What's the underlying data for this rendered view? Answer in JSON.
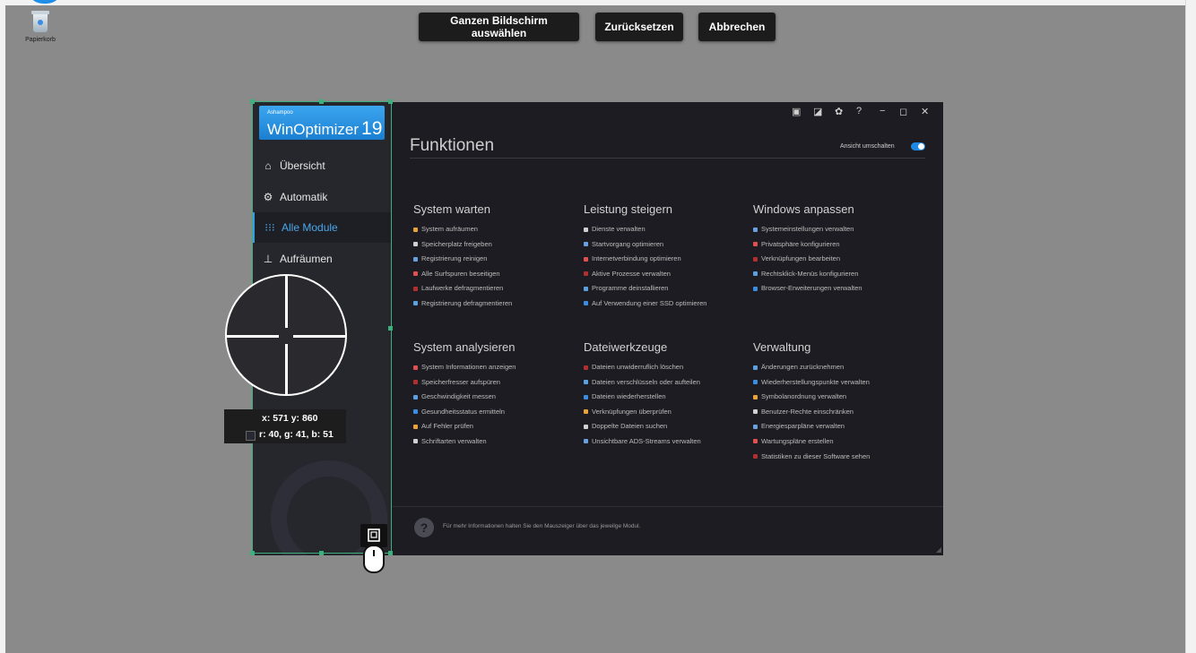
{
  "desktop": {
    "recycle_bin_label": "Papierkorb",
    "background_color": "#8a8a8a"
  },
  "overlay": {
    "buttons": [
      "Ganzen Bildschirm auswählen",
      "Zurücksetzen",
      "Abbrechen"
    ],
    "coords": "x: 571 y: 860",
    "rgb": "r: 40, g: 41, b: 51",
    "selection_color": "#3bb07a"
  },
  "app": {
    "brand": "Ashampoo",
    "name": "WinOptimizer",
    "version": "19",
    "accent": "#1e88e5",
    "window_controls": [
      "chat-icon",
      "note-icon",
      "gear-icon",
      "help-icon",
      "minimize-icon",
      "maximize-icon",
      "close-icon"
    ],
    "window_control_glyphs": [
      "▣",
      "◪",
      "✿",
      "?",
      "−",
      "◻",
      "✕"
    ],
    "nav": [
      {
        "label": "Übersicht",
        "icon": "home-icon",
        "glyph": "⌂"
      },
      {
        "label": "Automatik",
        "icon": "automation-icon",
        "glyph": "⚙"
      },
      {
        "label": "Alle Module",
        "icon": "grid-icon",
        "glyph": "⁝⁝⁝",
        "active": true
      },
      {
        "label": "Aufräumen",
        "icon": "broom-icon",
        "glyph": "⊥"
      }
    ],
    "title": "Funktionen",
    "toggle_label": "Ansicht umschalten",
    "groups": [
      {
        "title": "System warten",
        "items": [
          "System aufräumen",
          "Speicherplatz freigeben",
          "Registrierung reinigen",
          "Alle Surfspuren beseitigen",
          "Laufwerke defragmentieren",
          "Registrierung defragmentieren"
        ]
      },
      {
        "title": "Leistung steigern",
        "items": [
          "Dienste verwalten",
          "Startvorgang optimieren",
          "Internetverbindung optimieren",
          "Aktive Prozesse verwalten",
          "Programme deinstallieren",
          "Auf Verwendung einer SSD optimieren"
        ]
      },
      {
        "title": "Windows anpassen",
        "items": [
          "Systemeinstellungen verwalten",
          "Privatsphäre konfigurieren",
          "Verknüpfungen bearbeiten",
          "Rechtsklick-Menüs konfigurieren",
          "Browser-Erweiterungen verwalten"
        ]
      },
      {
        "title": "System analysieren",
        "items": [
          "System Informationen anzeigen",
          "Speicherfresser aufspüren",
          "Geschwindigkeit messen",
          "Gesundheitsstatus ermitteln",
          "Auf Fehler prüfen",
          "Schriftarten verwalten"
        ]
      },
      {
        "title": "Dateiwerkzeuge",
        "items": [
          "Dateien unwiderruflich löschen",
          "Dateien verschlüsseln oder aufteilen",
          "Dateien wiederherstellen",
          "Verknüpfungen überprüfen",
          "Doppelte Dateien suchen",
          "Unsichtbare ADS-Streams verwalten"
        ]
      },
      {
        "title": "Verwaltung",
        "items": [
          "Änderungen zurücknehmen",
          "Wiederherstellungspunkte verwalten",
          "Symbolanordnung verwalten",
          "Benutzer-Rechte einschränken",
          "Energiesparpläne verwalten",
          "Wartungspläne erstellen",
          "Statistiken zu dieser Software sehen"
        ]
      }
    ],
    "footer_help": "?",
    "footer": "Für mehr Informationen halten Sie den Mauszeiger über das jeweilge Modul."
  }
}
